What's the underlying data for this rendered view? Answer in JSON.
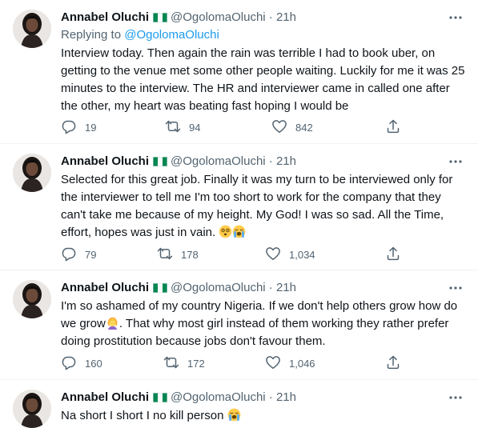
{
  "author": {
    "name": "Annabel Oluchi",
    "handle": "@OgolomaOluchi",
    "time": "21h",
    "separator": "·"
  },
  "colors": {
    "accent": "#1d9bf0",
    "secondary_text": "#536471",
    "flag_green": "#008751",
    "divider": "#eff3f4"
  },
  "icons": {
    "reply": "reply-icon",
    "retweet": "retweet-icon",
    "like": "heart-icon",
    "share": "share-icon",
    "more": "more-icon",
    "flag": "nigeria-flag-icon"
  },
  "tweets": [
    {
      "replying_prefix": "Replying to",
      "replying_to": "@OgolomaOluchi",
      "text": "Interview today. Then again the rain was terrible I had to book uber, on getting to the venue met some other people waiting. Luckily for me it was 25 minutes to the interview. The HR and interviewer came in called one after the other, my heart was beating fast hoping I would be",
      "replies": "19",
      "retweets": "94",
      "likes": "842"
    },
    {
      "text": "Selected for this great job. Finally it was my turn to be interviewed only for the interviewer to tell me I'm too short to work for the company that they can't take me because of my height.  My God! I was so sad. All the Time, effort, hopes was just in vain.",
      "emojis": [
        "face-with-spiral-eyes",
        "loudly-crying-face"
      ],
      "replies": "79",
      "retweets": "178",
      "likes": "1,034"
    },
    {
      "text_before_emoji": "I'm so ashamed of my country Nigeria. If we don't help others grow how do we grow",
      "emoji": "woman-facepalming",
      "text_after_emoji": ". That why most girl instead of them working they rather prefer doing prostitution because jobs don't favour them.",
      "replies": "160",
      "retweets": "172",
      "likes": "1,046"
    },
    {
      "text": "Na short I short I no kill person",
      "emoji": "loudly-crying-face"
    }
  ]
}
